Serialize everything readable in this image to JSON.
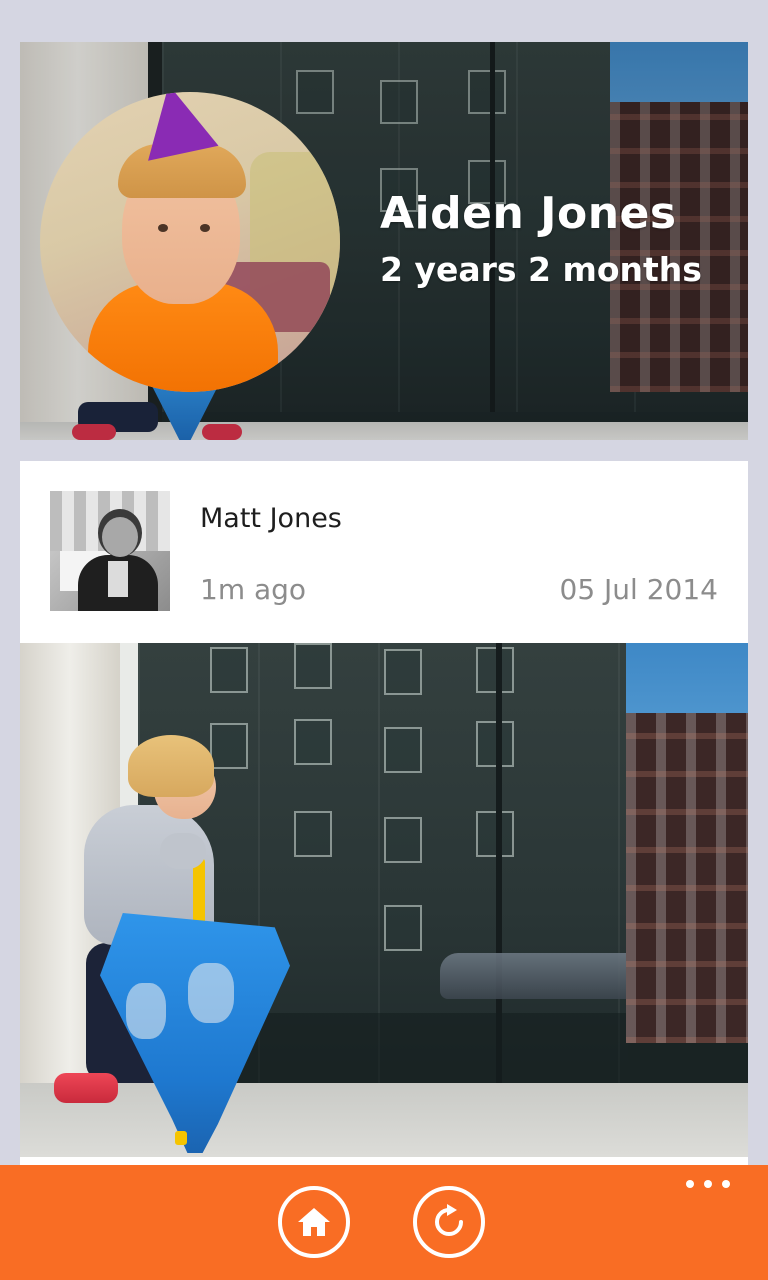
{
  "profile": {
    "name": "Aiden Jones",
    "age": "2 years 2 months"
  },
  "post": {
    "author": "Matt Jones",
    "time_ago": "1m ago",
    "date": "05 Jul 2014"
  },
  "app_bar": {
    "buttons": [
      {
        "icon": "home-icon"
      },
      {
        "icon": "refresh-icon"
      }
    ],
    "more_icon": "ellipsis-icon",
    "color": "#f96d24"
  }
}
